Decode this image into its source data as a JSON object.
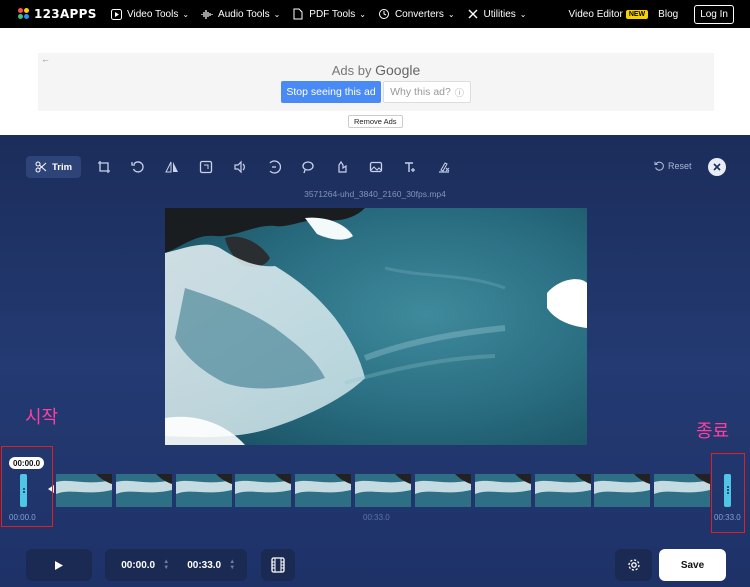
{
  "nav": {
    "logo": "123APPS",
    "items": [
      {
        "label": "Video Tools",
        "icon": "play-square-icon"
      },
      {
        "label": "Audio Tools",
        "icon": "waveform-icon"
      },
      {
        "label": "PDF Tools",
        "icon": "document-icon"
      },
      {
        "label": "Converters",
        "icon": "convert-icon"
      },
      {
        "label": "Utilities",
        "icon": "tools-icon"
      }
    ],
    "video_editor": "Video Editor",
    "new_badge": "NEW",
    "blog": "Blog",
    "login": "Log In"
  },
  "ad": {
    "ads_by": "Ads by",
    "brand": "Google",
    "stop": "Stop seeing this ad",
    "why": "Why this ad?",
    "remove": "Remove Ads"
  },
  "editor": {
    "trim_label": "Trim",
    "reset_label": "Reset",
    "filename": "3571264-uhd_3840_2160_30fps.mp4",
    "tools": [
      "crop-icon",
      "rotate-icon",
      "flip-icon",
      "resize-icon",
      "volume-icon",
      "speed-icon",
      "loop-icon",
      "stabilize-icon",
      "image-icon",
      "text-icon",
      "remove-logo-icon"
    ]
  },
  "annotations": {
    "start": "시작",
    "end": "종료"
  },
  "timeline": {
    "start_tooltip": "00:00.0",
    "start_time": "00:00.0",
    "mid_time": "00:33.0",
    "end_time": "00:33.0"
  },
  "controls": {
    "start_value": "00:00.0",
    "end_value": "00:33.0",
    "save": "Save"
  },
  "colors": {
    "accent_handle": "#4fc6e6",
    "editor_bg": "#1f3368",
    "annotation": "#ff3f9f",
    "highlight_box": "#e02020",
    "ad_button": "#4a8af4"
  }
}
